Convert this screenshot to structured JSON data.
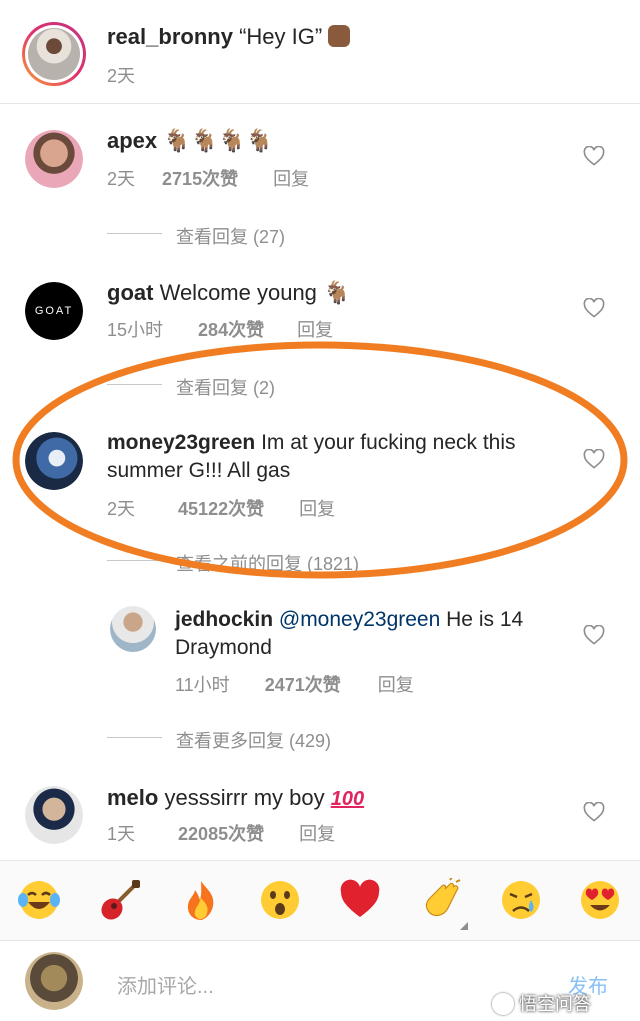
{
  "caption": {
    "username": "real_bronny",
    "text": "“Hey IG”",
    "emoji": "waving-hand-icon",
    "time": "2天"
  },
  "comments": [
    {
      "username": "apex",
      "text": "",
      "emoji": "goat-icon x4",
      "time": "2天",
      "likes": "2715次赞",
      "reply": "回复",
      "view_replies": "查看回复 (27)"
    },
    {
      "username": "goat",
      "text": "Welcome young",
      "emoji": "goat-icon",
      "avatar_text": "GOAT",
      "time": "15小时",
      "likes": "284次赞",
      "reply": "回复",
      "view_replies": "查看回复 (2)"
    },
    {
      "username": "money23green",
      "text_line1": "Im at your fucking neck this",
      "text_line2": "summer G!!! All gas",
      "time": "2天",
      "likes": "45122次赞",
      "reply": "回复",
      "view_replies": "查看之前的回复 (1821)",
      "highlight_color": "#f07d22"
    },
    {
      "username": "jedhockin",
      "mention": "@money23green",
      "text_line1": "He is 14",
      "text_line2": "Draymond",
      "time": "11小时",
      "likes": "2471次赞",
      "reply": "回复",
      "view_replies": "查看更多回复 (429)"
    },
    {
      "username": "melo",
      "text": "yesssirrr my boy",
      "emoji": "hundred-points-icon",
      "time": "1天",
      "likes": "22085次赞",
      "reply": "回复"
    }
  ],
  "emoji_bar": [
    "tears-of-joy-icon",
    "guitar-icon",
    "fire-icon",
    "astonished-face-icon",
    "red-heart-icon",
    "clapping-hands-icon",
    "sad-relieved-face-icon",
    "heart-eyes-icon"
  ],
  "composer": {
    "placeholder": "添加评论...",
    "post_label": "发布"
  },
  "watermark": "悟空问答",
  "colors": {
    "story_ring": "#e1306c",
    "link": "#003569",
    "post_blue": "#3897f0",
    "highlight": "#f07d22"
  }
}
